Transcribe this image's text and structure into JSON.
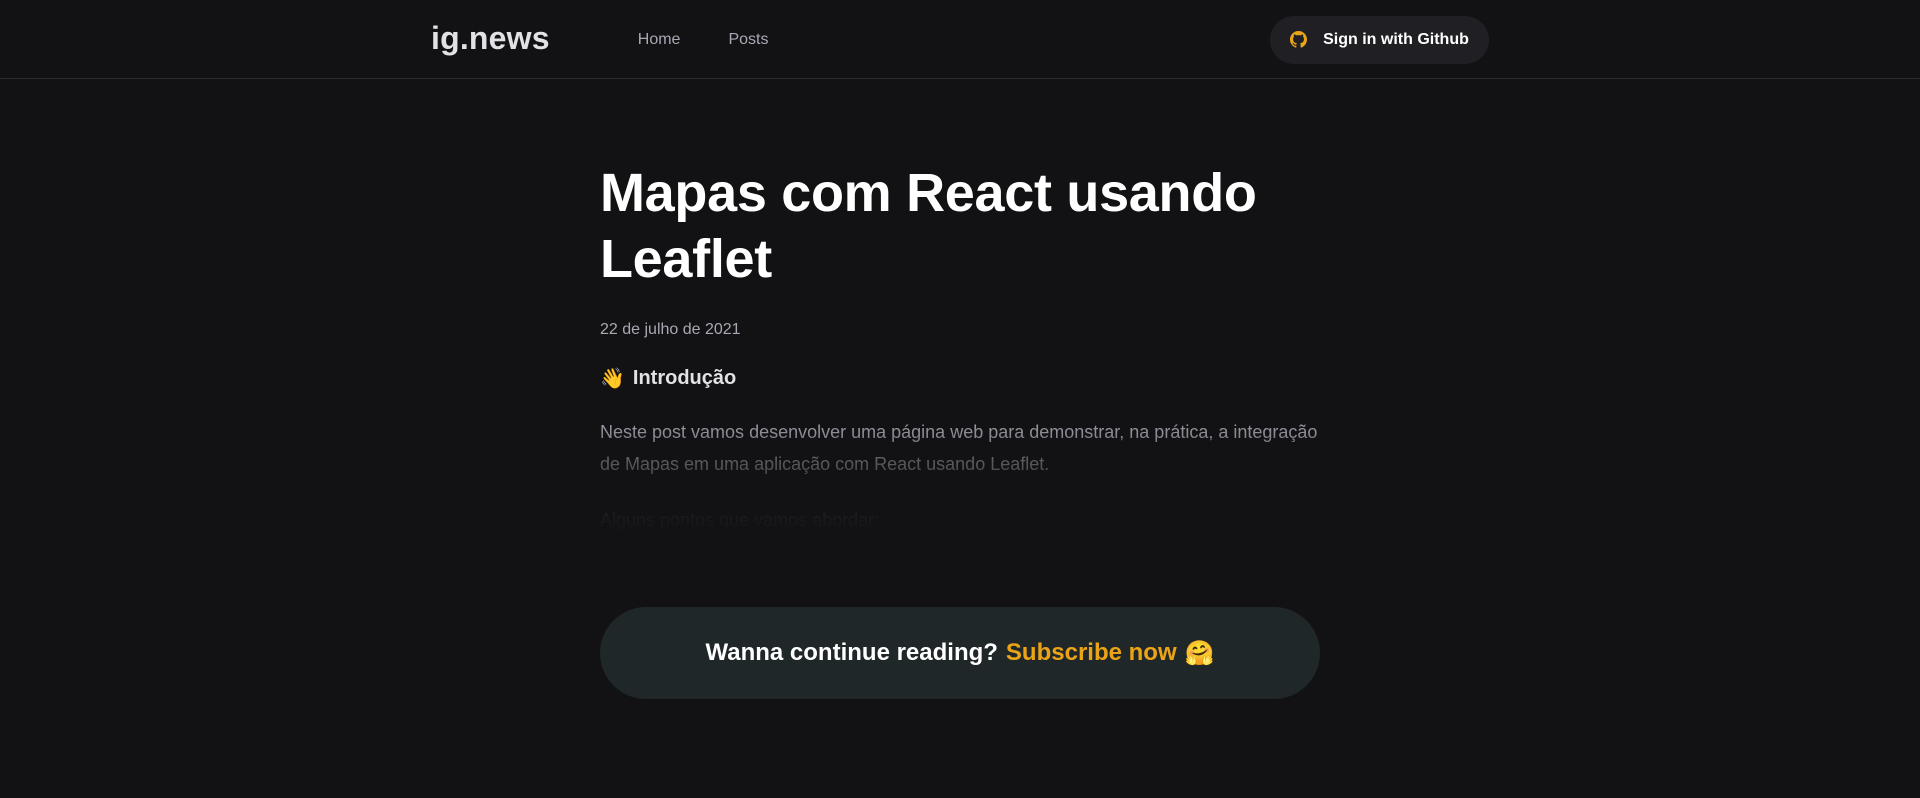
{
  "header": {
    "logo": "ig.news",
    "nav": [
      {
        "label": "Home"
      },
      {
        "label": "Posts"
      }
    ],
    "signin_label": "Sign in with Github",
    "signin_icon": "github-icon",
    "accent_color": "#eba417"
  },
  "post": {
    "title": "Mapas com React usando Leaflet",
    "date": "22 de julho de 2021",
    "section_heading": "Introdução",
    "section_icon": "waving-hand-icon",
    "paragraphs": [
      "Neste post vamos desenvolver uma página web para demonstrar, na prática, a integração de Mapas em uma aplicação com React usando Leaflet.",
      "Alguns pontos que vamos abordar:"
    ]
  },
  "continue_reading": {
    "prompt": "Wanna continue reading?",
    "link": "Subscribe now",
    "icon": "hugging-face-icon"
  }
}
